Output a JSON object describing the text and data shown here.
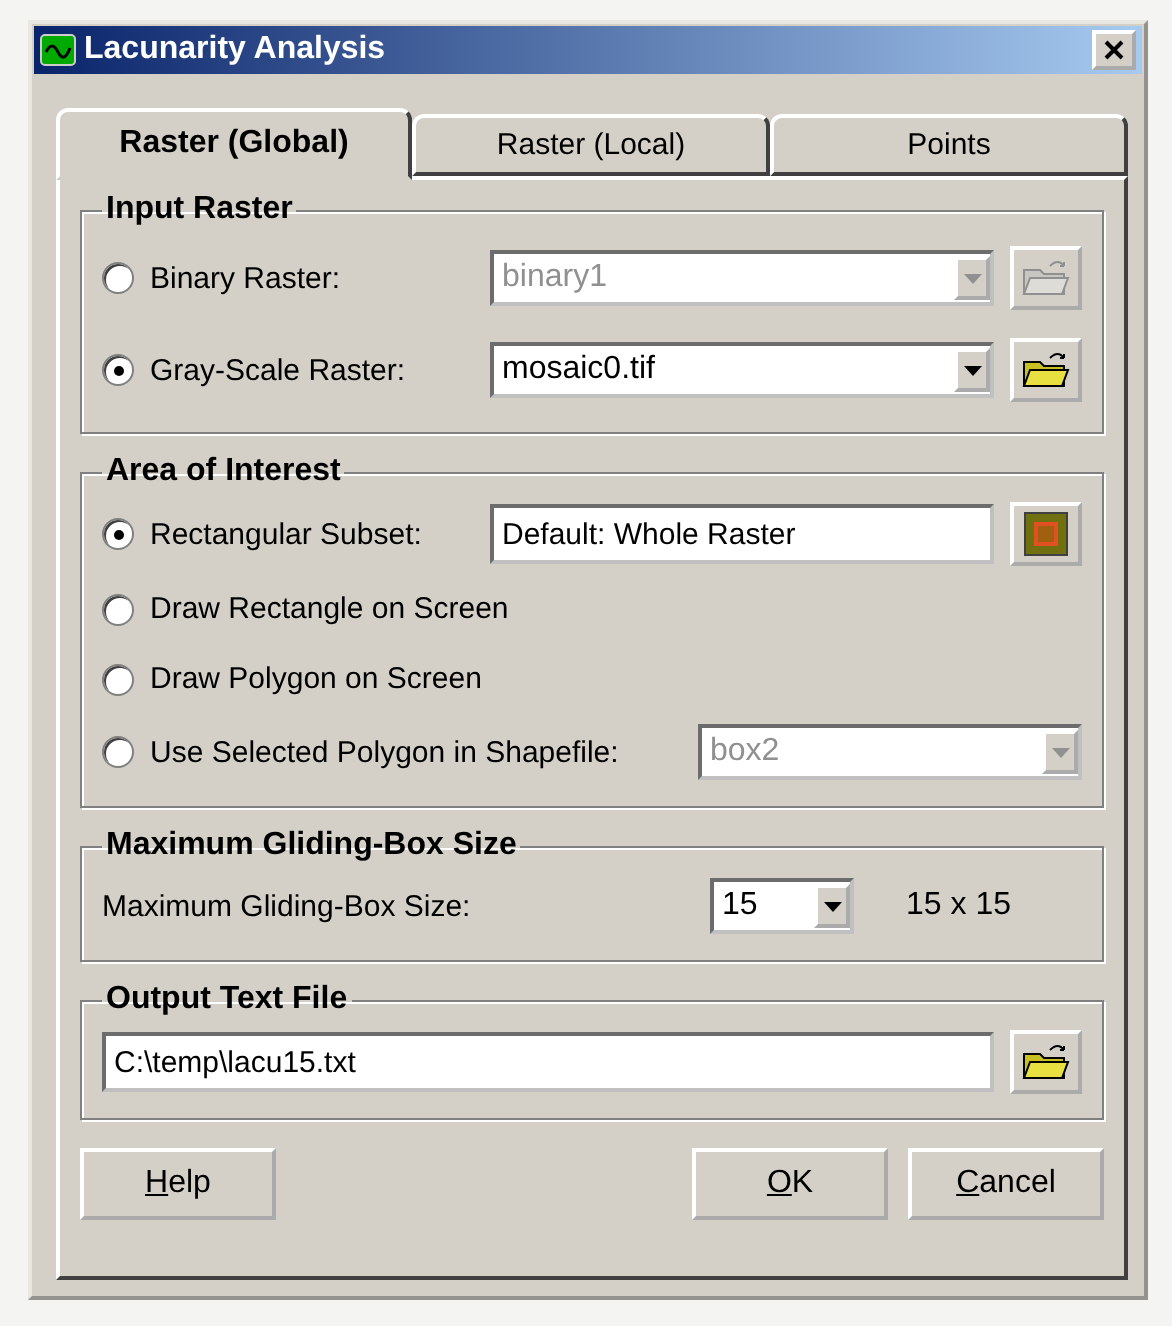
{
  "window": {
    "title": "Lacunarity Analysis"
  },
  "tabs": [
    {
      "label": "Raster (Global)",
      "selected": true
    },
    {
      "label": "Raster (Local)",
      "selected": false
    },
    {
      "label": "Points",
      "selected": false
    }
  ],
  "input_raster": {
    "title": "Input Raster",
    "options": [
      {
        "label": "Binary Raster:",
        "selected": false,
        "value": "binary1",
        "disabled": true
      },
      {
        "label": "Gray-Scale Raster:",
        "selected": true,
        "value": "mosaic0.tif",
        "disabled": false
      }
    ]
  },
  "area_of_interest": {
    "title": "Area of Interest",
    "options": [
      {
        "kind": "text",
        "label": "Rectangular Subset:",
        "selected": true,
        "value": "Default: Whole Raster"
      },
      {
        "kind": "plain",
        "label": "Draw Rectangle on Screen",
        "selected": false
      },
      {
        "kind": "plain",
        "label": "Draw Polygon on Screen",
        "selected": false
      },
      {
        "kind": "dropdown",
        "label": "Use Selected Polygon in Shapefile:",
        "selected": false,
        "value": "box2",
        "disabled": true
      }
    ]
  },
  "gliding_box": {
    "title": "Maximum Gliding-Box Size",
    "label": "Maximum Gliding-Box Size:",
    "value": "15",
    "result": "15 x 15"
  },
  "output_file": {
    "title": "Output Text File",
    "value": "C:\\temp\\lacu15.txt"
  },
  "buttons": [
    {
      "label": "Help",
      "kind": "left",
      "underline_first": true
    },
    {
      "label": "OK",
      "kind": "right",
      "underline_first": true
    },
    {
      "label": "Cancel",
      "kind": "right",
      "underline_first": true
    }
  ]
}
